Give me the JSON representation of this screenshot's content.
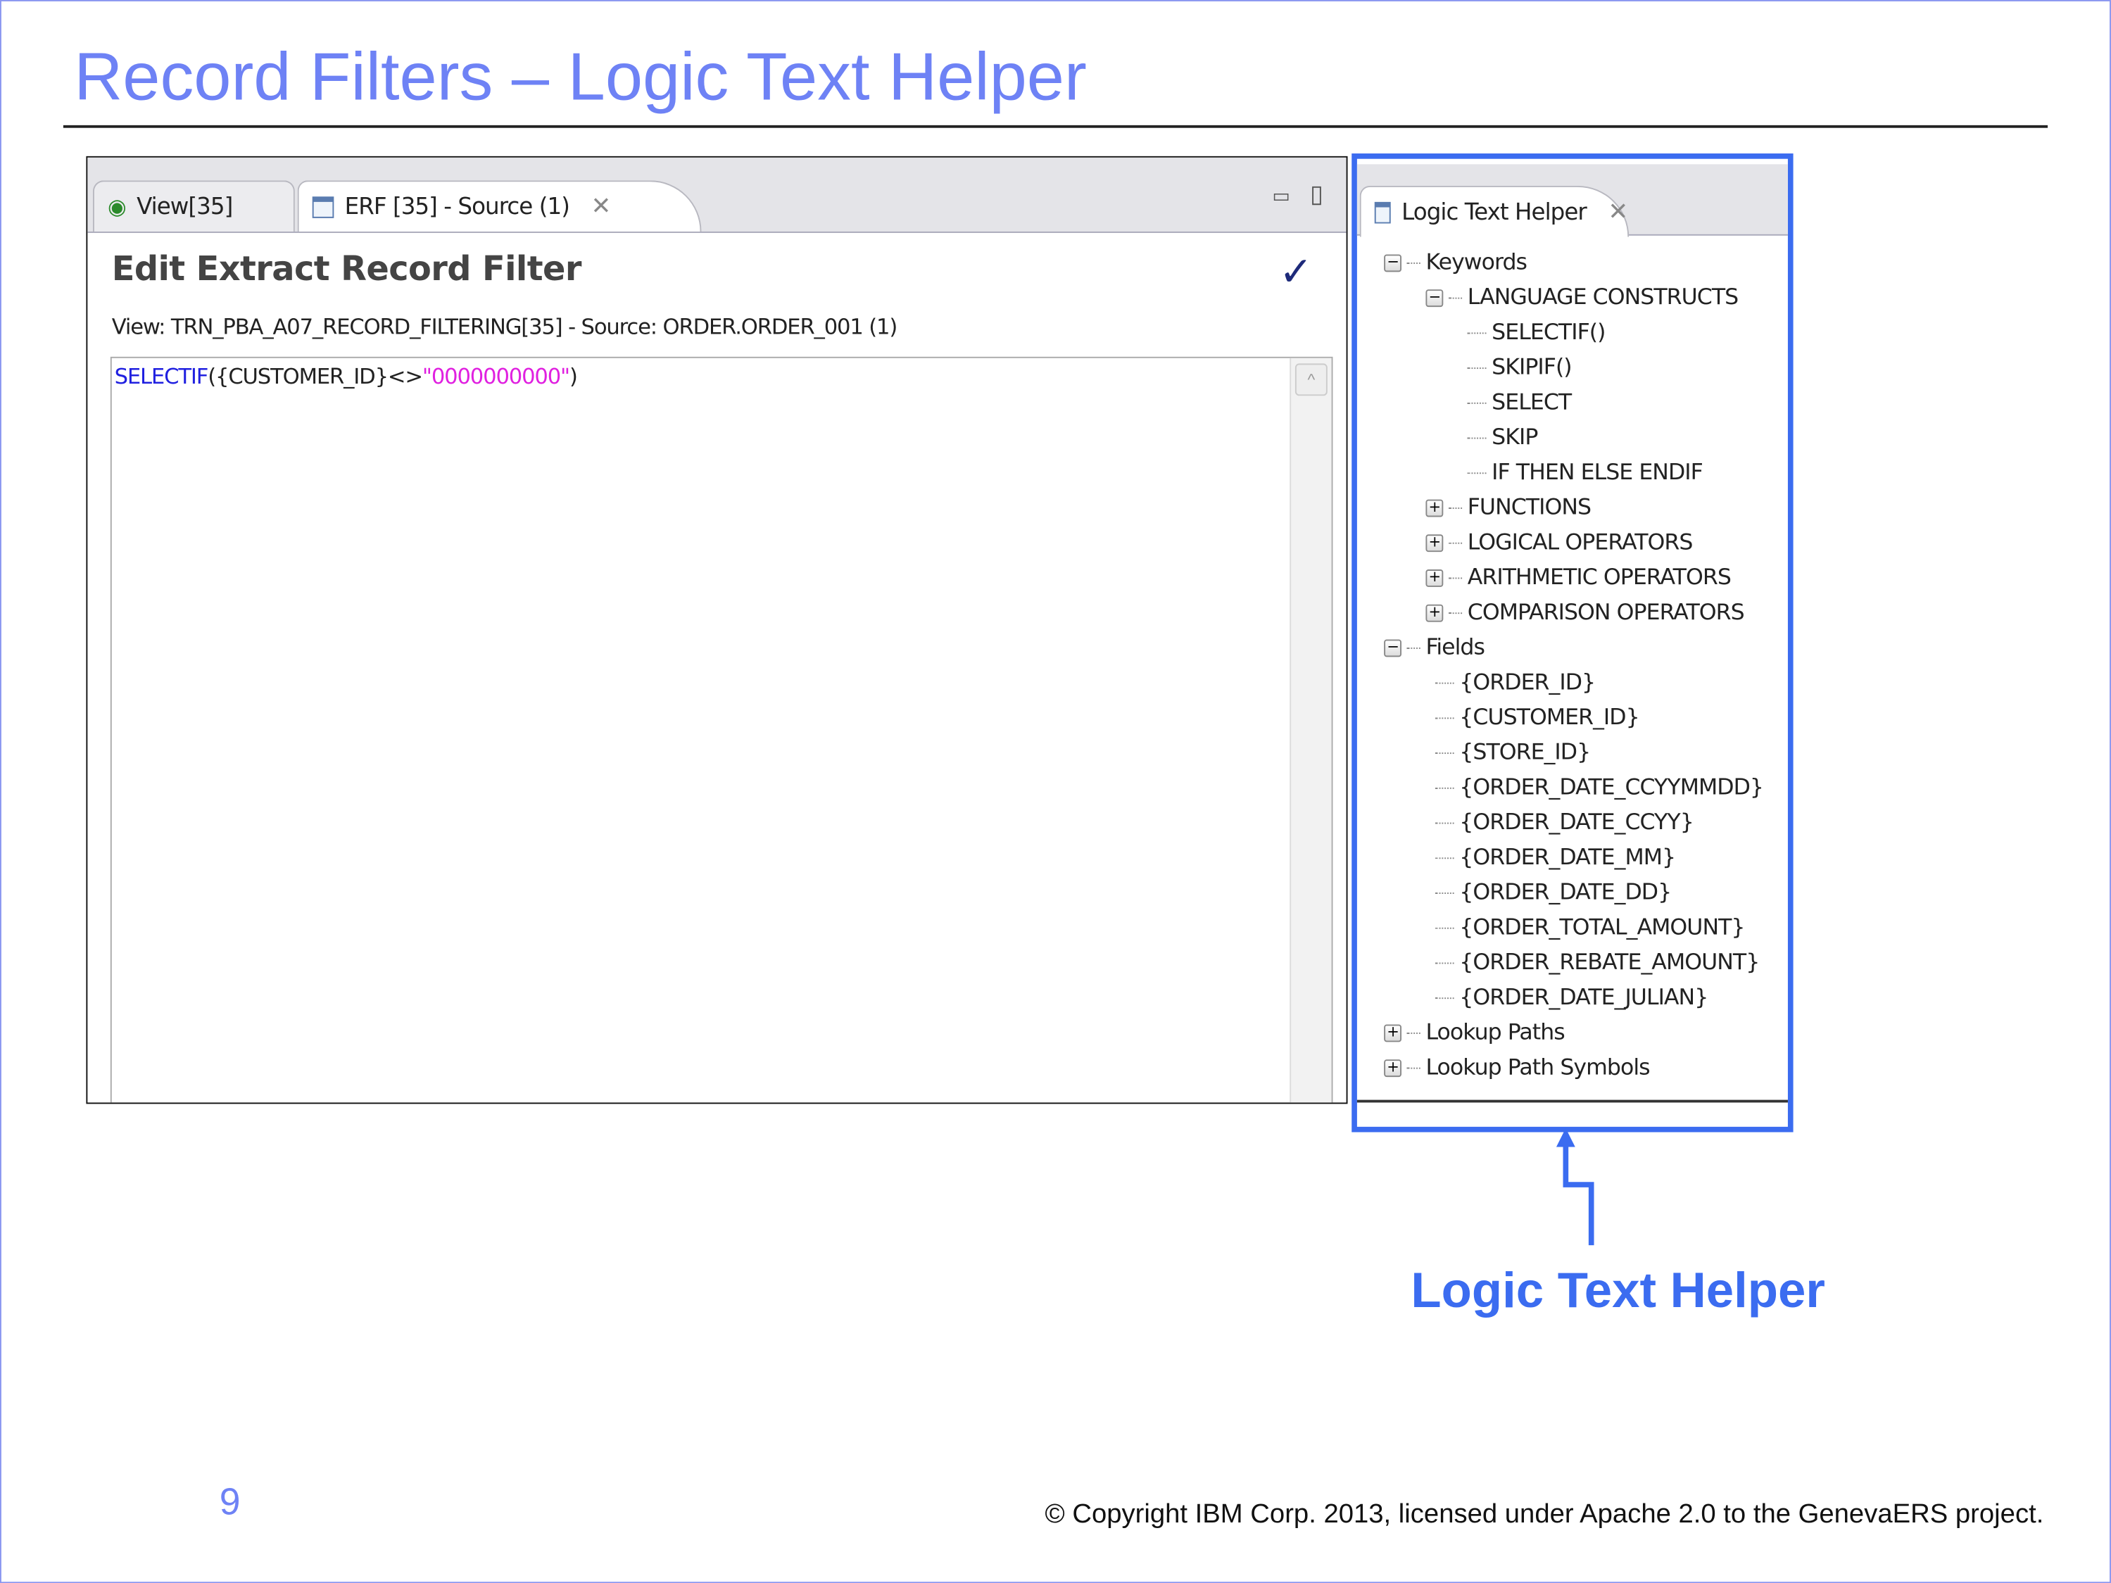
{
  "slide": {
    "title": "Record Filters – Logic Text Helper",
    "page_number": "9",
    "copyright": "© Copyright IBM Corp. 2013, licensed under Apache 2.0 to the GenevaERS project.",
    "callout_label": "Logic Text Helper",
    "accent": "#3b6cf0",
    "title_color": "#6e82f5"
  },
  "editor": {
    "tabs": [
      {
        "label": "View[35]"
      },
      {
        "label": "ERF [35] - Source (1)"
      }
    ],
    "heading": "Edit Extract Record Filter",
    "subtitle": "View: TRN_PBA_A07_RECORD_FILTERING[35] - Source: ORDER.ORDER_001 (1)",
    "code": {
      "keyword": "SELECTIF",
      "open": "({CUSTOMER_ID}<>",
      "string": "\"0000000000\"",
      "close": ")"
    }
  },
  "helper": {
    "tab_label": "Logic Text Helper",
    "tree": [
      {
        "label": "Keywords",
        "level": 0,
        "toggle": "−"
      },
      {
        "label": "LANGUAGE CONSTRUCTS",
        "level": 1,
        "toggle": "−"
      },
      {
        "label": "SELECTIF()",
        "level": 2
      },
      {
        "label": "SKIPIF()",
        "level": 2
      },
      {
        "label": "SELECT",
        "level": 2
      },
      {
        "label": "SKIP",
        "level": 2
      },
      {
        "label": "IF THEN ELSE ENDIF",
        "level": 2
      },
      {
        "label": "FUNCTIONS",
        "level": 1,
        "toggle": "+"
      },
      {
        "label": "LOGICAL OPERATORS",
        "level": 1,
        "toggle": "+"
      },
      {
        "label": "ARITHMETIC OPERATORS",
        "level": 1,
        "toggle": "+"
      },
      {
        "label": "COMPARISON OPERATORS",
        "level": 1,
        "toggle": "+"
      },
      {
        "label": "Fields",
        "level": 0,
        "toggle": "−"
      },
      {
        "label": "{ORDER_ID}",
        "level": 1
      },
      {
        "label": "{CUSTOMER_ID}",
        "level": 1
      },
      {
        "label": "{STORE_ID}",
        "level": 1
      },
      {
        "label": "{ORDER_DATE_CCYYMMDD}",
        "level": 1
      },
      {
        "label": "{ORDER_DATE_CCYY}",
        "level": 1
      },
      {
        "label": "{ORDER_DATE_MM}",
        "level": 1
      },
      {
        "label": "{ORDER_DATE_DD}",
        "level": 1
      },
      {
        "label": "{ORDER_TOTAL_AMOUNT}",
        "level": 1
      },
      {
        "label": "{ORDER_REBATE_AMOUNT}",
        "level": 1
      },
      {
        "label": "{ORDER_DATE_JULIAN}",
        "level": 1
      },
      {
        "label": "Lookup Paths",
        "level": 0,
        "toggle": "+"
      },
      {
        "label": "Lookup Path Symbols",
        "level": 0,
        "toggle": "+"
      }
    ]
  }
}
